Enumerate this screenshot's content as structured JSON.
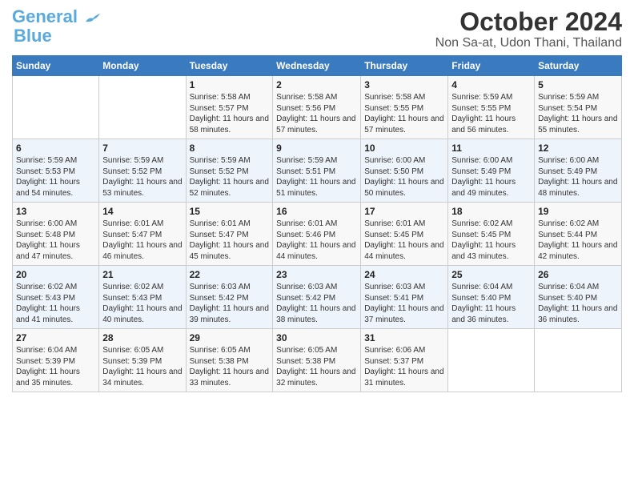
{
  "logo": {
    "line1": "General",
    "line2": "Blue"
  },
  "title": "October 2024",
  "subtitle": "Non Sa-at, Udon Thani, Thailand",
  "days_of_week": [
    "Sunday",
    "Monday",
    "Tuesday",
    "Wednesday",
    "Thursday",
    "Friday",
    "Saturday"
  ],
  "weeks": [
    [
      {
        "day": "",
        "info": ""
      },
      {
        "day": "",
        "info": ""
      },
      {
        "day": "1",
        "info": "Sunrise: 5:58 AM\nSunset: 5:57 PM\nDaylight: 11 hours and 58 minutes."
      },
      {
        "day": "2",
        "info": "Sunrise: 5:58 AM\nSunset: 5:56 PM\nDaylight: 11 hours and 57 minutes."
      },
      {
        "day": "3",
        "info": "Sunrise: 5:58 AM\nSunset: 5:55 PM\nDaylight: 11 hours and 57 minutes."
      },
      {
        "day": "4",
        "info": "Sunrise: 5:59 AM\nSunset: 5:55 PM\nDaylight: 11 hours and 56 minutes."
      },
      {
        "day": "5",
        "info": "Sunrise: 5:59 AM\nSunset: 5:54 PM\nDaylight: 11 hours and 55 minutes."
      }
    ],
    [
      {
        "day": "6",
        "info": "Sunrise: 5:59 AM\nSunset: 5:53 PM\nDaylight: 11 hours and 54 minutes."
      },
      {
        "day": "7",
        "info": "Sunrise: 5:59 AM\nSunset: 5:52 PM\nDaylight: 11 hours and 53 minutes."
      },
      {
        "day": "8",
        "info": "Sunrise: 5:59 AM\nSunset: 5:52 PM\nDaylight: 11 hours and 52 minutes."
      },
      {
        "day": "9",
        "info": "Sunrise: 5:59 AM\nSunset: 5:51 PM\nDaylight: 11 hours and 51 minutes."
      },
      {
        "day": "10",
        "info": "Sunrise: 6:00 AM\nSunset: 5:50 PM\nDaylight: 11 hours and 50 minutes."
      },
      {
        "day": "11",
        "info": "Sunrise: 6:00 AM\nSunset: 5:49 PM\nDaylight: 11 hours and 49 minutes."
      },
      {
        "day": "12",
        "info": "Sunrise: 6:00 AM\nSunset: 5:49 PM\nDaylight: 11 hours and 48 minutes."
      }
    ],
    [
      {
        "day": "13",
        "info": "Sunrise: 6:00 AM\nSunset: 5:48 PM\nDaylight: 11 hours and 47 minutes."
      },
      {
        "day": "14",
        "info": "Sunrise: 6:01 AM\nSunset: 5:47 PM\nDaylight: 11 hours and 46 minutes."
      },
      {
        "day": "15",
        "info": "Sunrise: 6:01 AM\nSunset: 5:47 PM\nDaylight: 11 hours and 45 minutes."
      },
      {
        "day": "16",
        "info": "Sunrise: 6:01 AM\nSunset: 5:46 PM\nDaylight: 11 hours and 44 minutes."
      },
      {
        "day": "17",
        "info": "Sunrise: 6:01 AM\nSunset: 5:45 PM\nDaylight: 11 hours and 44 minutes."
      },
      {
        "day": "18",
        "info": "Sunrise: 6:02 AM\nSunset: 5:45 PM\nDaylight: 11 hours and 43 minutes."
      },
      {
        "day": "19",
        "info": "Sunrise: 6:02 AM\nSunset: 5:44 PM\nDaylight: 11 hours and 42 minutes."
      }
    ],
    [
      {
        "day": "20",
        "info": "Sunrise: 6:02 AM\nSunset: 5:43 PM\nDaylight: 11 hours and 41 minutes."
      },
      {
        "day": "21",
        "info": "Sunrise: 6:02 AM\nSunset: 5:43 PM\nDaylight: 11 hours and 40 minutes."
      },
      {
        "day": "22",
        "info": "Sunrise: 6:03 AM\nSunset: 5:42 PM\nDaylight: 11 hours and 39 minutes."
      },
      {
        "day": "23",
        "info": "Sunrise: 6:03 AM\nSunset: 5:42 PM\nDaylight: 11 hours and 38 minutes."
      },
      {
        "day": "24",
        "info": "Sunrise: 6:03 AM\nSunset: 5:41 PM\nDaylight: 11 hours and 37 minutes."
      },
      {
        "day": "25",
        "info": "Sunrise: 6:04 AM\nSunset: 5:40 PM\nDaylight: 11 hours and 36 minutes."
      },
      {
        "day": "26",
        "info": "Sunrise: 6:04 AM\nSunset: 5:40 PM\nDaylight: 11 hours and 36 minutes."
      }
    ],
    [
      {
        "day": "27",
        "info": "Sunrise: 6:04 AM\nSunset: 5:39 PM\nDaylight: 11 hours and 35 minutes."
      },
      {
        "day": "28",
        "info": "Sunrise: 6:05 AM\nSunset: 5:39 PM\nDaylight: 11 hours and 34 minutes."
      },
      {
        "day": "29",
        "info": "Sunrise: 6:05 AM\nSunset: 5:38 PM\nDaylight: 11 hours and 33 minutes."
      },
      {
        "day": "30",
        "info": "Sunrise: 6:05 AM\nSunset: 5:38 PM\nDaylight: 11 hours and 32 minutes."
      },
      {
        "day": "31",
        "info": "Sunrise: 6:06 AM\nSunset: 5:37 PM\nDaylight: 11 hours and 31 minutes."
      },
      {
        "day": "",
        "info": ""
      },
      {
        "day": "",
        "info": ""
      }
    ]
  ]
}
